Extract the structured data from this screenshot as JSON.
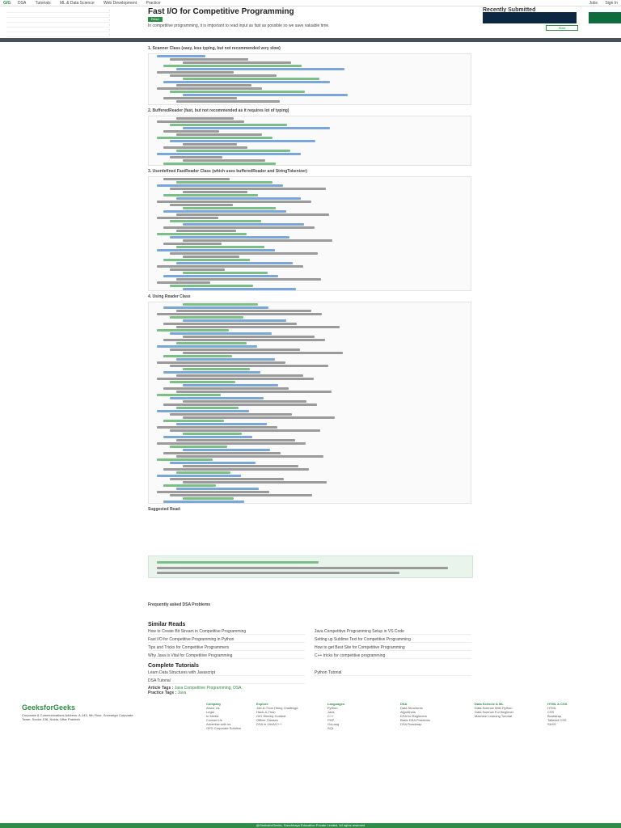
{
  "topnav": {
    "logo": "GfG",
    "items": [
      "DSA",
      "Tutorials",
      "ML & Data Science",
      "Web Development",
      "Practice"
    ],
    "right": [
      "Jobs",
      "Sign In"
    ]
  },
  "article": {
    "title": "Fast I/O for Competitive Programming",
    "tag": "Read",
    "intro": "In competitive programming, it is important to read input as fast as possible so we save valuable time.",
    "sections": [
      {
        "title": "1. Scanner Class (easy, less typing, but not recommended very slow)"
      },
      {
        "title": "2. BufferedReader (fast, but not recommended as it requires lot of typing)"
      },
      {
        "title": "3. Userdefined FastReader Class (which uses bufferedReader and StringTokenizer)"
      },
      {
        "title": "4. Using Reader Class"
      }
    ],
    "suggested": "Suggested Read:",
    "faq_button": "Frequently asked DSA Problems"
  },
  "similar": {
    "title": "Similar Reads",
    "items": [
      "How to Create Bit Stream in Competitive Programming",
      "Java Competitive Programming Setup in VS Code",
      "Fast I/O for Competitive Programming in Python",
      "Setting up Sublime Text for Competitive Programming",
      "Tips and Tricks for Competitive Programmers",
      "How to get Best Site for Competitive Programming",
      "Why Java is Vital for Competitive Programming",
      "C++ tricks for competitive programming"
    ]
  },
  "complete": {
    "title": "Complete Tutorials",
    "items": [
      "Learn Data Structures with Javascript",
      "Python Tutorial",
      "DSA Tutorial"
    ]
  },
  "tags": {
    "article_tags_label": "Article Tags :",
    "article_tags": "Java Competitive Programming, DSA",
    "practice_tags_label": "Practice Tags :",
    "practice_tags": "Java"
  },
  "recent": {
    "title": "Recently Submitted",
    "button": "Start"
  },
  "footer": {
    "logo": "GeeksforGeeks",
    "address": "Corporate & Communications Address: A-143, 9th Floor, Sovereign Corporate Tower, Sector-136, Noida, Uttar Pradesh",
    "columns": [
      {
        "head": "Company",
        "links": [
          "About Us",
          "Legal",
          "In Media",
          "Contact Us",
          "Advertise with us",
          "GFG Corporate Solution"
        ]
      },
      {
        "head": "Explore",
        "links": [
          "Job-A-Thon Hiring Challenge",
          "Hack-A-Thon",
          "GfG Weekly Contest",
          "Offline Classes",
          "DSA in JAVA/C++"
        ]
      },
      {
        "head": "Languages",
        "links": [
          "Python",
          "Java",
          "C++",
          "PHP",
          "GoLang",
          "SQL"
        ]
      },
      {
        "head": "DSA",
        "links": [
          "Data Structures",
          "Algorithms",
          "DSA for Beginners",
          "Basic DSA Problems",
          "DSA Roadmap"
        ]
      },
      {
        "head": "Data Science & ML",
        "links": [
          "Data Science With Python",
          "Data Science For Beginner",
          "Machine Learning Tutorial"
        ]
      },
      {
        "head": "HTML & CSS",
        "links": [
          "HTML",
          "CSS",
          "Bootstrap",
          "Tailwind CSS",
          "SASS"
        ]
      }
    ],
    "bottom": "@GeeksforGeeks, Sanchhaya Education Private Limited, All rights reserved"
  }
}
